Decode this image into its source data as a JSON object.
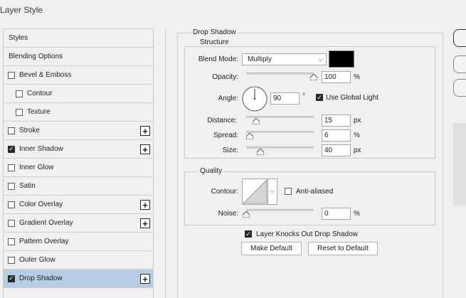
{
  "window": {
    "title": "Layer Style"
  },
  "styles_list": [
    {
      "label": "Styles",
      "type": "header"
    },
    {
      "label": "Blending Options",
      "type": "header"
    },
    {
      "label": "Bevel & Emboss",
      "checkbox": false
    },
    {
      "label": "Contour",
      "checkbox": false,
      "indent": true
    },
    {
      "label": "Texture",
      "checkbox": false,
      "indent": true
    },
    {
      "label": "Stroke",
      "checkbox": false,
      "plus": true
    },
    {
      "label": "Inner Shadow",
      "checkbox": true,
      "plus": true
    },
    {
      "label": "Inner Glow",
      "checkbox": false
    },
    {
      "label": "Satin",
      "checkbox": false
    },
    {
      "label": "Color Overlay",
      "checkbox": false,
      "plus": true
    },
    {
      "label": "Gradient Overlay",
      "checkbox": false,
      "plus": true
    },
    {
      "label": "Pattern Overlay",
      "checkbox": false
    },
    {
      "label": "Outer Glow",
      "checkbox": false
    },
    {
      "label": "Drop Shadow",
      "checkbox": true,
      "plus": true,
      "selected": true
    }
  ],
  "drop_shadow": {
    "title": "Drop Shadow",
    "structure": {
      "legend": "Structure",
      "blend_mode_label": "Blend Mode:",
      "blend_mode_value": "Multiply",
      "shadow_color": "#000000",
      "opacity_label": "Opacity:",
      "opacity_value": "100",
      "opacity_unit": "%",
      "angle_label": "Angle:",
      "angle_value": "90",
      "angle_unit": "°",
      "use_global_light_label": "Use Global Light",
      "use_global_light_checked": true,
      "distance_label": "Distance:",
      "distance_value": "15",
      "distance_unit": "px",
      "spread_label": "Spread:",
      "spread_value": "6",
      "spread_unit": "%",
      "size_label": "Size:",
      "size_value": "40",
      "size_unit": "px"
    },
    "quality": {
      "legend": "Quality",
      "contour_label": "Contour:",
      "anti_aliased_label": "Anti-aliased",
      "anti_aliased_checked": false,
      "noise_label": "Noise:",
      "noise_value": "0",
      "noise_unit": "%"
    },
    "knockout_label": "Layer Knocks Out Drop Shadow",
    "knockout_checked": true,
    "make_default_label": "Make Default",
    "reset_default_label": "Reset to Default"
  }
}
